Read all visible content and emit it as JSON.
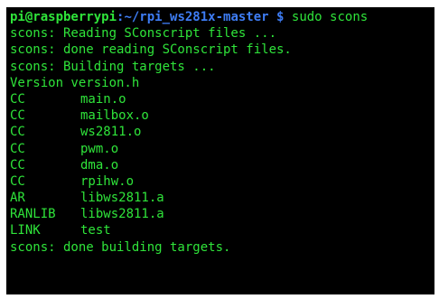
{
  "prompt": {
    "user_host": "pi@raspberrypi",
    "path": ":~/rpi_ws281x-master",
    "symbol": " $ ",
    "command": "sudo scons"
  },
  "output": {
    "line_0": "scons: Reading SConscript files ...",
    "line_1": "scons: done reading SConscript files.",
    "line_2": "scons: Building targets ...",
    "line_3": "Version version.h",
    "build_steps": [
      {
        "tag": "CC",
        "file": "main.o"
      },
      {
        "tag": "CC",
        "file": "mailbox.o"
      },
      {
        "tag": "CC",
        "file": "ws2811.o"
      },
      {
        "tag": "CC",
        "file": "pwm.o"
      },
      {
        "tag": "CC",
        "file": "dma.o"
      },
      {
        "tag": "CC",
        "file": "rpihw.o"
      },
      {
        "tag": "AR",
        "file": "libws2811.a"
      },
      {
        "tag": "RANLIB",
        "file": "libws2811.a"
      },
      {
        "tag": "LINK",
        "file": "test"
      }
    ],
    "final": "scons: done building targets."
  },
  "colors": {
    "background": "#000000",
    "text_green": "#2fe43a",
    "prompt_blue": "#3e7df5"
  }
}
